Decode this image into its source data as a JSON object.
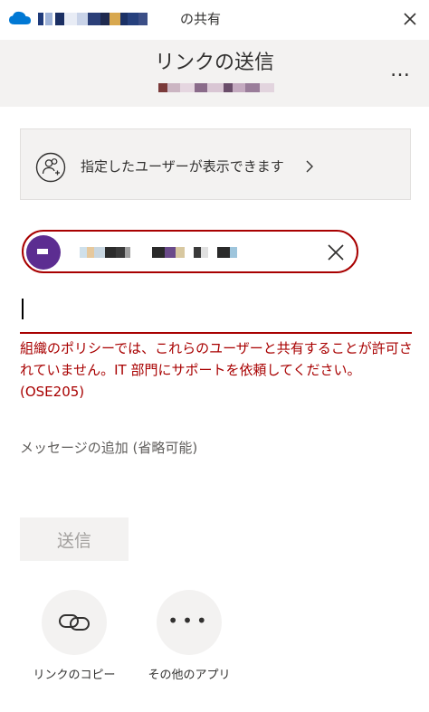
{
  "titlebar": {
    "title_suffix": "の共有",
    "cloud_icon": "onedrive-cloud-icon",
    "close_icon": "close-icon"
  },
  "header": {
    "title": "リンクの送信",
    "more_label": "…"
  },
  "permission": {
    "label": "指定したユーザーが表示できます",
    "icon": "people-icon"
  },
  "recipient": {
    "remove_icon": "close-icon"
  },
  "error": {
    "lines": [
      "組織のポリシーでは、これらのユーザーと共有することが許可さ",
      "れていません。IT 部門にサポートを依頼してください。",
      "(OSE205)"
    ]
  },
  "message": {
    "placeholder": "メッセージの追加 (省略可能)"
  },
  "send": {
    "label": "送信"
  },
  "actions": {
    "copy_link": "リンクのコピー",
    "other_apps": "その他のアプリ"
  },
  "colors": {
    "error": "#a80000",
    "accent": "#0078d4",
    "avatar": "#5c2d91",
    "panel": "#f3f2f1"
  }
}
